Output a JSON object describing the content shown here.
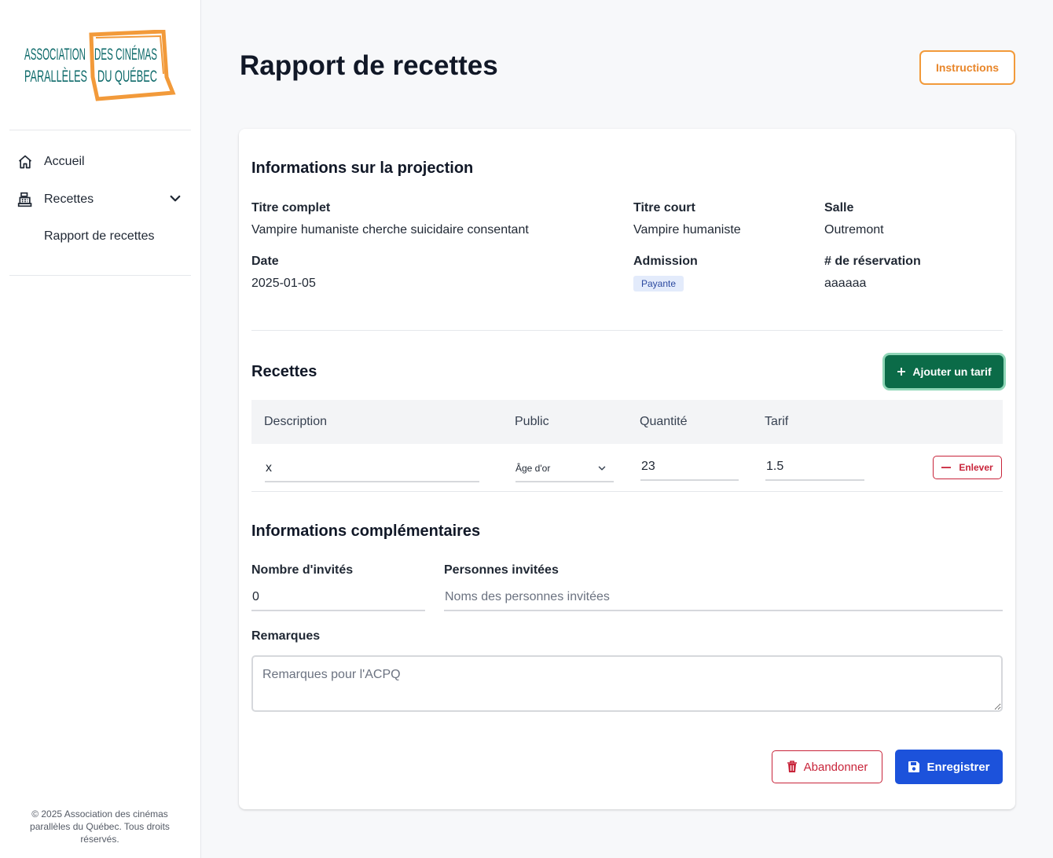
{
  "sidebar": {
    "logo": {
      "line1_left": "ASSOCIATION",
      "line1_right": "DES CINÉMAS",
      "line2_left": "PARALLÈLES",
      "line2_right": "DU QUÉBEC"
    },
    "nav": [
      {
        "label": "Accueil",
        "icon": "home-icon"
      },
      {
        "label": "Recettes",
        "icon": "cash-register-icon",
        "expanded": true
      }
    ],
    "sub_item": "Rapport de recettes",
    "copyright": "© 2025 Association des cinémas parallèles du Québec. Tous droits réservés."
  },
  "header": {
    "title": "Rapport de recettes",
    "instructions_label": "Instructions"
  },
  "projection": {
    "section_title": "Informations sur la projection",
    "fields": {
      "titre_complet": {
        "label": "Titre complet",
        "value": "Vampire humaniste cherche suicidaire consentant"
      },
      "titre_court": {
        "label": "Titre court",
        "value": "Vampire humaniste"
      },
      "salle": {
        "label": "Salle",
        "value": "Outremont"
      },
      "date": {
        "label": "Date",
        "value": "2025-01-05"
      },
      "admission": {
        "label": "Admission",
        "value": "Payante"
      },
      "reservation": {
        "label": "# de réservation",
        "value": "aaaaaa"
      }
    }
  },
  "recettes": {
    "section_title": "Recettes",
    "add_label": "Ajouter un tarif",
    "columns": [
      "Description",
      "Public",
      "Quantité",
      "Tarif"
    ],
    "rows": [
      {
        "description": "x",
        "public": "Âge d'or",
        "quantite": "23",
        "tarif": "1.5",
        "remove_label": "Enlever"
      }
    ]
  },
  "complementaires": {
    "section_title": "Informations complémentaires",
    "invites_label": "Nombre d'invités",
    "invites_value": "0",
    "personnes_label": "Personnes invitées",
    "personnes_placeholder": "Noms des personnes invitées",
    "remarques_label": "Remarques",
    "remarques_placeholder": "Remarques pour l'ACPQ"
  },
  "actions": {
    "cancel_label": "Abandonner",
    "save_label": "Enregistrer"
  },
  "colors": {
    "accent_orange": "#f29a3a",
    "primary_green": "#0b6b48",
    "primary_blue": "#1c52db",
    "danger_red": "#c8243a"
  }
}
